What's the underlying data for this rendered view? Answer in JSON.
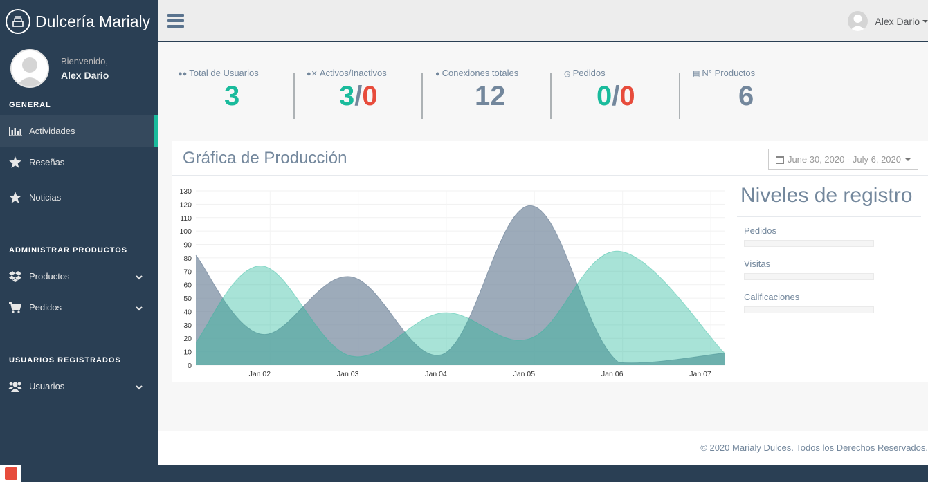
{
  "brand": {
    "name": "Dulcería Marialy",
    "icon": "cake-icon"
  },
  "profile": {
    "welcome": "Bienvenido,",
    "name": "Alex Dario"
  },
  "sidebar": {
    "sections": [
      {
        "title": "GENERAL",
        "items": [
          {
            "label": "Actividades",
            "icon": "bar-chart-icon",
            "active": true
          },
          {
            "label": "Reseñas",
            "icon": "star-icon"
          },
          {
            "label": "Noticias",
            "icon": "star-icon"
          }
        ]
      },
      {
        "title": "ADMINISTRAR PRODUCTOS",
        "items": [
          {
            "label": "Productos",
            "icon": "dropbox-icon",
            "chevron": true
          },
          {
            "label": "Pedidos",
            "icon": "cart-icon",
            "chevron": true
          }
        ]
      },
      {
        "title": "USUARIOS REGISTRADOS",
        "items": [
          {
            "label": "Usuarios",
            "icon": "users-icon",
            "chevron": true
          }
        ]
      }
    ]
  },
  "topnav": {
    "user_name": "Alex Dario"
  },
  "tiles": [
    {
      "label": "Total de Usuarios",
      "icon": "users-icon",
      "value": "3"
    },
    {
      "label": "Activos/Inactivos",
      "icon": "user-times-icon",
      "value_a": "3",
      "sep": "/",
      "value_b": "0"
    },
    {
      "label": "Conexiones totales",
      "icon": "user-icon",
      "value": "12"
    },
    {
      "label": "Pedidos",
      "icon": "clock-icon",
      "value_a": "0",
      "sep": "/",
      "value_b": "0"
    },
    {
      "label": "N° Productos",
      "icon": "list-icon",
      "value": "6"
    }
  ],
  "panel": {
    "title": "Gráfica de Producción",
    "daterange": "June 30, 2020 - July 6, 2020"
  },
  "niveles": {
    "title": "Niveles de registro",
    "items": [
      {
        "label": "Pedidos",
        "progress": 0
      },
      {
        "label": "Visitas",
        "progress": 0
      },
      {
        "label": "Calificaciones",
        "progress": 0
      }
    ]
  },
  "footer": {
    "text": "© 2020 Marialy Dulces. Todos los Derechos Reservados."
  },
  "colors": {
    "accent": "#1abb9c",
    "danger": "#e74c3c",
    "sidebar": "#2a3f54",
    "series_a": "#96ca59",
    "series_b": "#3f97eb"
  },
  "chart_data": {
    "type": "area",
    "categories": [
      "Jan 02",
      "Jan 03",
      "Jan 04",
      "Jan 05",
      "Jan 06",
      "Jan 07"
    ],
    "ylim": [
      0,
      130
    ],
    "yticks": [
      0,
      10,
      20,
      30,
      40,
      50,
      60,
      70,
      80,
      90,
      100,
      110,
      120,
      130
    ],
    "grid": true,
    "x": [
      1.0,
      1.75,
      2.75,
      3.8,
      4.8,
      5.8,
      7.0
    ],
    "series": [
      {
        "color": "#73879c",
        "values": [
          82,
          23,
          66,
          8,
          119,
          2,
          9
        ]
      },
      {
        "color": "#26B99A",
        "values": [
          17,
          74,
          7,
          39,
          20,
          85,
          9
        ]
      }
    ]
  }
}
